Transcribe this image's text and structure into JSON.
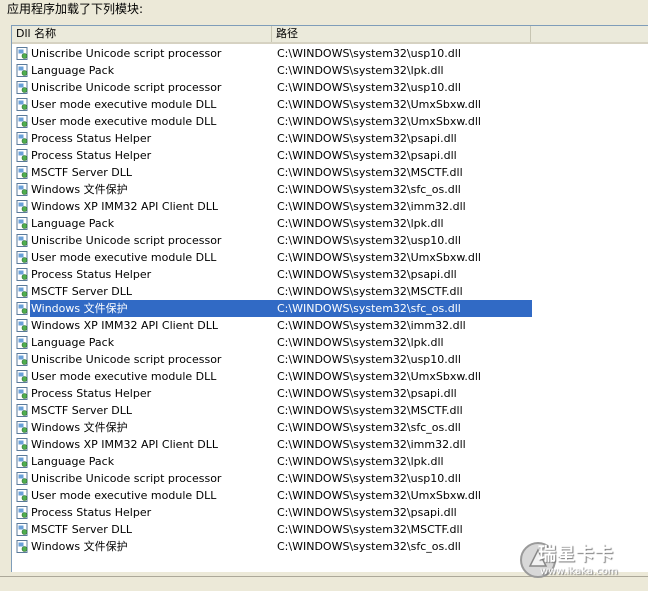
{
  "title": "应用程序加载了下列模块:",
  "columns": [
    "Dll 名称",
    "路径",
    ""
  ],
  "icon": "dll-module-icon",
  "selected_index": 15,
  "selection_color": "#316ac5",
  "rows": [
    {
      "name": "Uniscribe Unicode script processor",
      "path": "C:\\WINDOWS\\system32\\usp10.dll"
    },
    {
      "name": "Language Pack",
      "path": "C:\\WINDOWS\\system32\\lpk.dll"
    },
    {
      "name": "Uniscribe Unicode script processor",
      "path": "C:\\WINDOWS\\system32\\usp10.dll"
    },
    {
      "name": "User mode executive module DLL",
      "path": "C:\\WINDOWS\\system32\\UmxSbxw.dll"
    },
    {
      "name": "User mode executive module DLL",
      "path": "C:\\WINDOWS\\system32\\UmxSbxw.dll"
    },
    {
      "name": "Process Status Helper",
      "path": "C:\\WINDOWS\\system32\\psapi.dll"
    },
    {
      "name": "Process Status Helper",
      "path": "C:\\WINDOWS\\system32\\psapi.dll"
    },
    {
      "name": "MSCTF Server DLL",
      "path": "C:\\WINDOWS\\system32\\MSCTF.dll"
    },
    {
      "name": "Windows 文件保护",
      "path": "C:\\WINDOWS\\system32\\sfc_os.dll"
    },
    {
      "name": "Windows XP IMM32 API Client DLL",
      "path": "C:\\WINDOWS\\system32\\imm32.dll"
    },
    {
      "name": "Language Pack",
      "path": "C:\\WINDOWS\\system32\\lpk.dll"
    },
    {
      "name": "Uniscribe Unicode script processor",
      "path": "C:\\WINDOWS\\system32\\usp10.dll"
    },
    {
      "name": "User mode executive module DLL",
      "path": "C:\\WINDOWS\\system32\\UmxSbxw.dll"
    },
    {
      "name": "Process Status Helper",
      "path": "C:\\WINDOWS\\system32\\psapi.dll"
    },
    {
      "name": "MSCTF Server DLL",
      "path": "C:\\WINDOWS\\system32\\MSCTF.dll"
    },
    {
      "name": "Windows 文件保护",
      "path": "C:\\WINDOWS\\system32\\sfc_os.dll"
    },
    {
      "name": "Windows XP IMM32 API Client DLL",
      "path": "C:\\WINDOWS\\system32\\imm32.dll"
    },
    {
      "name": "Language Pack",
      "path": "C:\\WINDOWS\\system32\\lpk.dll"
    },
    {
      "name": "Uniscribe Unicode script processor",
      "path": "C:\\WINDOWS\\system32\\usp10.dll"
    },
    {
      "name": "User mode executive module DLL",
      "path": "C:\\WINDOWS\\system32\\UmxSbxw.dll"
    },
    {
      "name": "Process Status Helper",
      "path": "C:\\WINDOWS\\system32\\psapi.dll"
    },
    {
      "name": "MSCTF Server DLL",
      "path": "C:\\WINDOWS\\system32\\MSCTF.dll"
    },
    {
      "name": "Windows 文件保护",
      "path": "C:\\WINDOWS\\system32\\sfc_os.dll"
    },
    {
      "name": "Windows XP IMM32 API Client DLL",
      "path": "C:\\WINDOWS\\system32\\imm32.dll"
    },
    {
      "name": "Language Pack",
      "path": "C:\\WINDOWS\\system32\\lpk.dll"
    },
    {
      "name": "Uniscribe Unicode script processor",
      "path": "C:\\WINDOWS\\system32\\usp10.dll"
    },
    {
      "name": "User mode executive module DLL",
      "path": "C:\\WINDOWS\\system32\\UmxSbxw.dll"
    },
    {
      "name": "Process Status Helper",
      "path": "C:\\WINDOWS\\system32\\psapi.dll"
    },
    {
      "name": "MSCTF Server DLL",
      "path": "C:\\WINDOWS\\system32\\MSCTF.dll"
    },
    {
      "name": "Windows 文件保护",
      "path": "C:\\WINDOWS\\system32\\sfc_os.dll"
    }
  ],
  "watermark": {
    "logo_icon": "ikaka-logo-icon",
    "text": "瑞星卡卡",
    "url": "www.ikaka.com"
  }
}
